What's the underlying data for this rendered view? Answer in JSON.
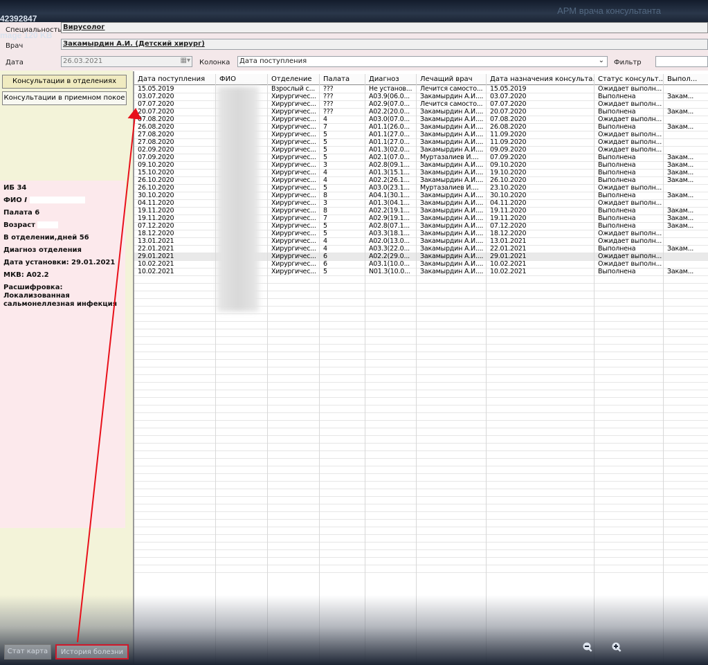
{
  "app_title": "АРМ врача консультанта",
  "overlay": {
    "id": "42392847",
    "size": "mage 120 KB"
  },
  "header": {
    "spec_label": "Специальность",
    "spec_value": "Вирусолог",
    "doctor_label": "Врач",
    "doctor_value": "Закамырдин А.И. (Детский хирург)",
    "date_label": "Дата",
    "date_value": "26.03.2021",
    "column_label": "Колонка",
    "column_value": "Дата поступления",
    "filter_label": "Фильтр",
    "filter_value": ""
  },
  "left_tabs": [
    "Консультации в отделениях",
    "Консультации в приемном покое"
  ],
  "info": {
    "ib": "ИБ 34",
    "fio": "ФИО",
    "ward": "Палата 6",
    "age": "Возраст",
    "days": "В отделении,дней 56",
    "dept_dx": "Диагноз отделения",
    "date_set": "Дата установки: 29.01.2021",
    "mkb": "МКВ: A02.2",
    "decode": "Расшифровка: Локализованная сальмонеллезная инфекция"
  },
  "grid": {
    "columns": [
      "Дата поступления",
      "ФИО",
      "Отделение",
      "Палата",
      "Диагноз",
      "Лечащий врач",
      "Дата назначения консульта...",
      "Статус консульт...",
      "Выпол..."
    ],
    "rows": [
      [
        "15.05.2019",
        "",
        "Взрослый с...",
        "???",
        "Не установ...",
        "Лечится самосто...",
        "15.05.2019",
        "Ожидает выполн...",
        ""
      ],
      [
        "03.07.2020",
        "",
        "Хирургичес...",
        "???",
        "A03.9(06.0...",
        "Закамырдин А.И....",
        "03.07.2020",
        "Выполнена",
        "Закам..."
      ],
      [
        "07.07.2020",
        "",
        "Хирургичес...",
        "???",
        "A02.9(07.0...",
        "Лечится самосто...",
        "07.07.2020",
        "Ожидает выполн...",
        ""
      ],
      [
        "20.07.2020",
        "",
        "Хирургичес...",
        "???",
        "A02.2(20.0...",
        "Закамырдин А.И....",
        "20.07.2020",
        "Выполнена",
        "Закам..."
      ],
      [
        "07.08.2020",
        "",
        "Хирургичес...",
        "4",
        "A03.0(07.0...",
        "Закамырдин А.И....",
        "07.08.2020",
        "Ожидает выполн...",
        ""
      ],
      [
        "26.08.2020",
        "",
        "Хирургичес...",
        "7",
        "A01.1(26.0...",
        "Закамырдин А.И....",
        "26.08.2020",
        "Выполнена",
        "Закам..."
      ],
      [
        "27.08.2020",
        "",
        "Хирургичес...",
        "5",
        "A01.1(27.0...",
        "Закамырдин А.И....",
        "11.09.2020",
        "Ожидает выполн...",
        ""
      ],
      [
        "27.08.2020",
        "",
        "Хирургичес...",
        "5",
        "A01.1(27.0...",
        "Закамырдин А.И....",
        "11.09.2020",
        "Ожидает выполн...",
        ""
      ],
      [
        "02.09.2020",
        "",
        "Хирургичес...",
        "5",
        "A01.3(02.0...",
        "Закамырдин А.И....",
        "09.09.2020",
        "Ожидает выполн...",
        ""
      ],
      [
        "07.09.2020",
        "",
        "Хирургичес...",
        "5",
        "A02.1(07.0...",
        "Муртазалиев И....",
        "07.09.2020",
        "Выполнена",
        "Закам..."
      ],
      [
        "09.10.2020",
        "",
        "Хирургичес...",
        "3",
        "A02.8(09.1...",
        "Закамырдин А.И....",
        "09.10.2020",
        "Выполнена",
        "Закам..."
      ],
      [
        "15.10.2020",
        "",
        "Хирургичес...",
        "4",
        "A01.3(15.1...",
        "Закамырдин А.И....",
        "19.10.2020",
        "Выполнена",
        "Закам..."
      ],
      [
        "26.10.2020",
        "",
        "Хирургичес...",
        "4",
        "A02.2(26.1...",
        "Закамырдин А.И....",
        "26.10.2020",
        "Выполнена",
        "Закам..."
      ],
      [
        "26.10.2020",
        "",
        "Хирургичес...",
        "5",
        "A03.0(23.1...",
        "Муртазалиев И....",
        "23.10.2020",
        "Ожидает выполн...",
        ""
      ],
      [
        "30.10.2020",
        "",
        "Хирургичес...",
        "8",
        "A04.1(30.1...",
        "Закамырдин А.И....",
        "30.10.2020",
        "Выполнена",
        "Закам..."
      ],
      [
        "04.11.2020",
        "",
        "Хирургичес...",
        "3",
        "A01.3(04.1...",
        "Закамырдин А.И....",
        "04.11.2020",
        "Ожидает выполн...",
        ""
      ],
      [
        "19.11.2020",
        "",
        "Хирургичес...",
        "8",
        "A02.2(19.1...",
        "Закамырдин А.И....",
        "19.11.2020",
        "Выполнена",
        "Закам..."
      ],
      [
        "19.11.2020",
        "",
        "Хирургичес...",
        "7",
        "A02.9(19.1...",
        "Закамырдин А.И....",
        "19.11.2020",
        "Выполнена",
        "Закам..."
      ],
      [
        "07.12.2020",
        "",
        "Хирургичес...",
        "5",
        "A02.8(07.1...",
        "Закамырдин А.И....",
        "07.12.2020",
        "Выполнена",
        "Закам..."
      ],
      [
        "18.12.2020",
        "",
        "Хирургичес...",
        "5",
        "A03.3(18.1...",
        "Закамырдин А.И....",
        "18.12.2020",
        "Ожидает выполн...",
        ""
      ],
      [
        "13.01.2021",
        "",
        "Хирургичес...",
        "4",
        "A02.0(13.0...",
        "Закамырдин А.И....",
        "13.01.2021",
        "Ожидает выполн...",
        ""
      ],
      [
        "22.01.2021",
        "",
        "Хирургичес...",
        "4",
        "A03.3(22.0...",
        "Закамырдин А.И....",
        "22.01.2021",
        "Выполнена",
        "Закам..."
      ],
      [
        "29.01.2021",
        "",
        "Хирургичес...",
        "6",
        "A02.2(29.0...",
        "Закамырдин А.И....",
        "29.01.2021",
        "Ожидает выполн...",
        ""
      ],
      [
        "10.02.2021",
        "",
        "Хирургичес...",
        "6",
        "A03.1(10.0...",
        "Закамырдин А.И....",
        "10.02.2021",
        "Ожидает выполн...",
        ""
      ],
      [
        "10.02.2021",
        "",
        "Хирургичес...",
        "5",
        "N01.3(10.0...",
        "Закамырдин А.И....",
        "10.02.2021",
        "Выполнена",
        "Закам..."
      ]
    ],
    "selected_row": 22
  },
  "bottom": {
    "stat_card": "Стат карта",
    "history": "История болезни"
  },
  "icons": {
    "zoom_out": "zoom-out-icon",
    "zoom_in": "zoom-in-icon"
  },
  "colors": {
    "highlight": "#d0182a",
    "arrow": "#e8101a"
  }
}
